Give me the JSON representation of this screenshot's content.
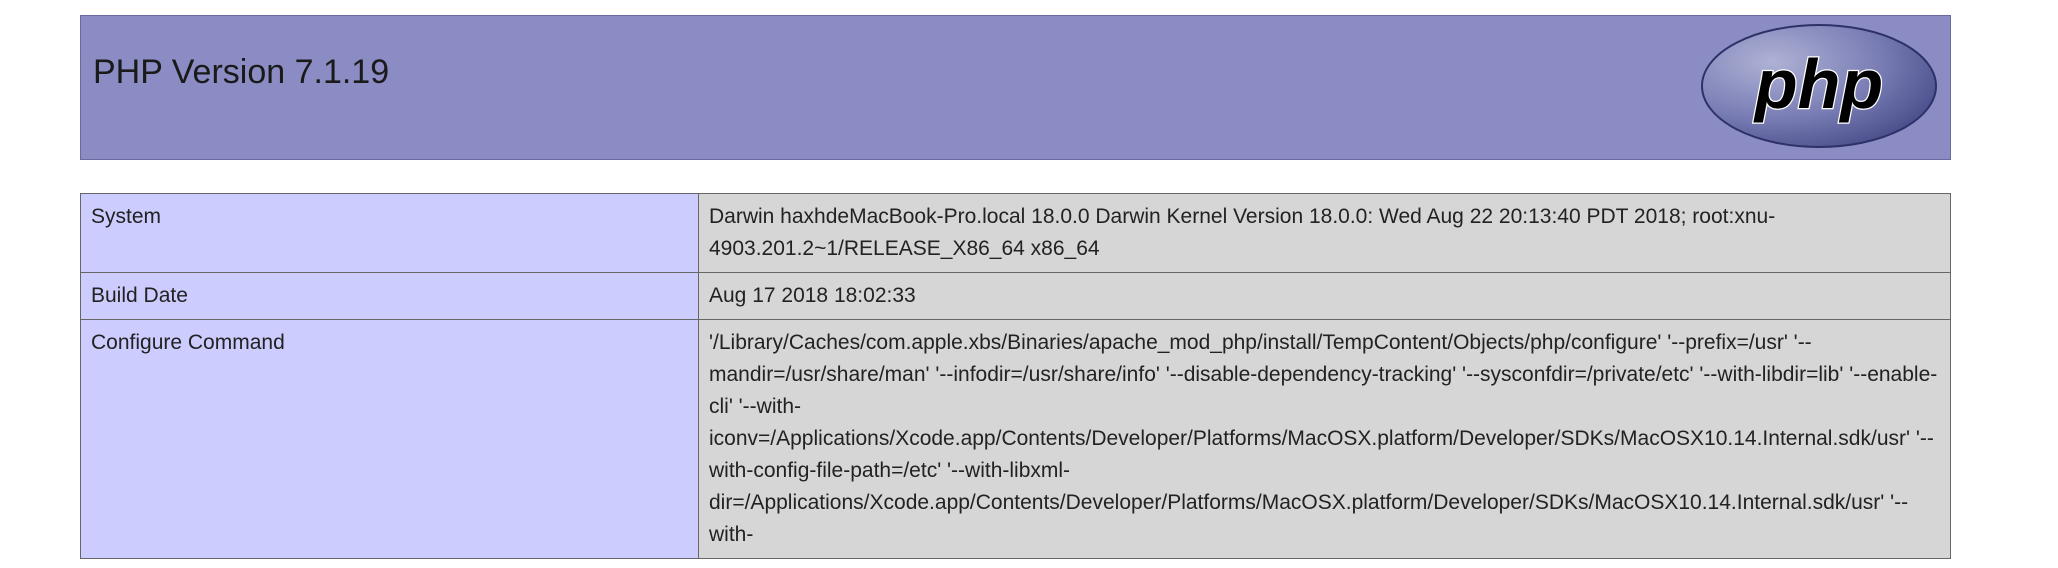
{
  "header": {
    "title": "PHP Version 7.1.19",
    "logo_text": "php",
    "colors": {
      "header_bg": "#8c8cc4",
      "key_bg": "#ccccff",
      "value_bg": "#d6d6d6",
      "logo_fill": "#7377ad"
    }
  },
  "rows": [
    {
      "key": "System",
      "value": "Darwin haxhdeMacBook-Pro.local 18.0.0 Darwin Kernel Version 18.0.0: Wed Aug 22 20:13:40 PDT 2018; root:xnu-4903.201.2~1/RELEASE_X86_64 x86_64"
    },
    {
      "key": "Build Date",
      "value": "Aug 17 2018 18:02:33"
    },
    {
      "key": "Configure Command",
      "value": "'/Library/Caches/com.apple.xbs/Binaries/apache_mod_php/install/TempContent/Objects/php/configure' '--prefix=/usr' '--mandir=/usr/share/man' '--infodir=/usr/share/info' '--disable-dependency-tracking' '--sysconfdir=/private/etc' '--with-libdir=lib' '--enable-cli' '--with-iconv=/Applications/Xcode.app/Contents/Developer/Platforms/MacOSX.platform/Developer/SDKs/MacOSX10.14.Internal.sdk/usr' '--with-config-file-path=/etc' '--with-libxml-dir=/Applications/Xcode.app/Contents/Developer/Platforms/MacOSX.platform/Developer/SDKs/MacOSX10.14.Internal.sdk/usr' '--with-"
    }
  ]
}
